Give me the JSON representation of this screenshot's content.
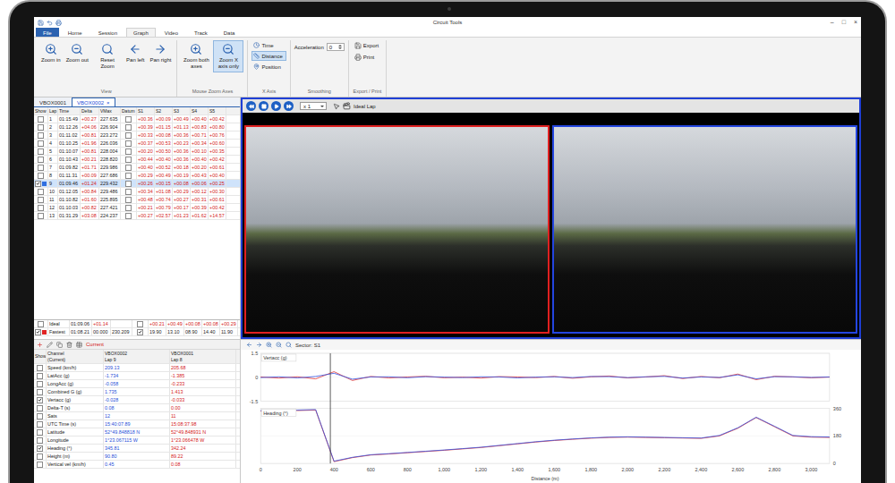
{
  "window": {
    "title": "Circuit Tools",
    "controls": [
      "–",
      "□",
      "×"
    ]
  },
  "ribbon_tabs": [
    {
      "label": "File",
      "kind": "file",
      "selected": false
    },
    {
      "label": "Home",
      "kind": "tab",
      "selected": false
    },
    {
      "label": "Session",
      "kind": "tab",
      "selected": false
    },
    {
      "label": "Graph",
      "kind": "tab",
      "selected": true
    },
    {
      "label": "Video",
      "kind": "tab",
      "selected": false
    },
    {
      "label": "Track",
      "kind": "tab",
      "selected": false
    },
    {
      "label": "Data",
      "kind": "tab",
      "selected": false
    }
  ],
  "ribbon": {
    "view": {
      "label": "View",
      "buttons": [
        {
          "label": "Zoom in"
        },
        {
          "label": "Zoom out"
        },
        {
          "label": "Reset Zoom"
        },
        {
          "label": "Pan left"
        },
        {
          "label": "Pan right"
        }
      ]
    },
    "zoom_axes": {
      "label": "Mouse Zoom Axes",
      "buttons": [
        {
          "label": "Zoom both axes",
          "selected": false
        },
        {
          "label": "Zoom X axis only",
          "selected": true
        }
      ]
    },
    "x_axis": {
      "label": "X Axis",
      "options": [
        {
          "label": "Time",
          "selected": false
        },
        {
          "label": "Distance",
          "selected": true
        },
        {
          "label": "Position",
          "selected": false
        }
      ]
    },
    "smoothing": {
      "label": "Smoothing",
      "field": "Acceleration",
      "value": "0"
    },
    "export": {
      "label": "Export / Print",
      "buttons": [
        "Export",
        "Print"
      ]
    }
  },
  "file_tabs": [
    {
      "label": "VBOX0001",
      "selected": false
    },
    {
      "label": "VBOX0002",
      "selected": true,
      "close": "×"
    }
  ],
  "laps": {
    "columns": [
      "Show",
      "Lap",
      "Time",
      "Delta",
      "VMax",
      "Datum",
      "S1",
      "S2",
      "S3",
      "S4",
      "S5"
    ],
    "rows": [
      {
        "lap": "1",
        "time": "01:15.49",
        "delta": "+00.27",
        "vmax": "227.635",
        "sectors": [
          "+00.36",
          "+00.09",
          "+00.49",
          "+00.40",
          "+00.42"
        ],
        "show": false,
        "datum": false,
        "selected": false
      },
      {
        "lap": "2",
        "time": "01:12.26",
        "delta": "+04.06",
        "vmax": "226.904",
        "sectors": [
          "+00.39",
          "+01.15",
          "+01.13",
          "+00.83",
          "+00.80"
        ],
        "show": false,
        "datum": false,
        "selected": false
      },
      {
        "lap": "3",
        "time": "01:11.02",
        "delta": "+00.81",
        "vmax": "223.272",
        "sectors": [
          "+00.33",
          "+00.08",
          "+00.36",
          "+00.71",
          "+00.76"
        ],
        "show": false,
        "datum": false,
        "selected": false
      },
      {
        "lap": "4",
        "time": "01:10.25",
        "delta": "+01.96",
        "vmax": "226.036",
        "sectors": [
          "+00.37",
          "+00.53",
          "+00.23",
          "+00.34",
          "+00.60"
        ],
        "show": false,
        "datum": false,
        "selected": false
      },
      {
        "lap": "5",
        "time": "01:10.07",
        "delta": "+00.81",
        "vmax": "228.004",
        "sectors": [
          "+00.20",
          "+00.50",
          "+00.36",
          "+00.10",
          "+00.35"
        ],
        "show": false,
        "datum": false,
        "selected": false
      },
      {
        "lap": "6",
        "time": "01:10.43",
        "delta": "+00.21",
        "vmax": "228.820",
        "sectors": [
          "+00.44",
          "+00.40",
          "+00.36",
          "+00.40",
          "+00.42"
        ],
        "show": false,
        "datum": false,
        "selected": false
      },
      {
        "lap": "7",
        "time": "01:09.82",
        "delta": "+01.71",
        "vmax": "229.986",
        "sectors": [
          "+00.40",
          "+00.52",
          "+00.18",
          "+00.20",
          "+00.61"
        ],
        "show": false,
        "datum": false,
        "selected": false
      },
      {
        "lap": "8",
        "time": "01:11.31",
        "delta": "+00.09",
        "vmax": "227.686",
        "sectors": [
          "+00.29",
          "+00.49",
          "+00.19",
          "+00.43",
          "+00.40"
        ],
        "show": false,
        "datum": false,
        "selected": false
      },
      {
        "lap": "9",
        "time": "01:09.46",
        "delta": "+01.24",
        "vmax": "229.432",
        "sectors": [
          "+00.26",
          "+00.15",
          "+00.08",
          "+00.06",
          "+00.25"
        ],
        "show": true,
        "datum": false,
        "selected": true,
        "color": "#2f6fe0"
      },
      {
        "lap": "10",
        "time": "01:12.05",
        "delta": "+00.84",
        "vmax": "229.486",
        "sectors": [
          "+00.34",
          "+01.08",
          "+00.29",
          "+00.12",
          "+00.30"
        ],
        "show": false,
        "datum": false,
        "selected": false
      },
      {
        "lap": "11",
        "time": "01:10.82",
        "delta": "+01.60",
        "vmax": "225.895",
        "sectors": [
          "+00.48",
          "+00.74",
          "+00.27",
          "+00.31",
          "+00.61"
        ],
        "show": false,
        "datum": false,
        "selected": false
      },
      {
        "lap": "12",
        "time": "01:10.03",
        "delta": "+00.82",
        "vmax": "227.421",
        "sectors": [
          "+00.21",
          "+00.79",
          "+00.17",
          "+00.39",
          "+00.42"
        ],
        "show": false,
        "datum": false,
        "selected": false
      },
      {
        "lap": "13",
        "time": "01:31.29",
        "delta": "+03.08",
        "vmax": "224.237",
        "sectors": [
          "+00.27",
          "+02.57",
          "+01.23",
          "+01.62",
          "+14.57"
        ],
        "show": false,
        "datum": false,
        "selected": false
      }
    ],
    "summary": [
      {
        "label": "Ideal",
        "kind": "ideal",
        "time": "01:09.06",
        "delta": "+01.14",
        "sectors": [
          "+00.21",
          "+00.49",
          "+00.08",
          "+00.08",
          "+00.29"
        ],
        "show": false,
        "datum": false
      },
      {
        "label": "Fastest",
        "kind": "fastest",
        "time": "01:08.21",
        "delta": "00.000",
        "vmax": "230.209",
        "sectors": [
          "19.90",
          "13.10",
          "08.90",
          "14.40",
          "11.90"
        ],
        "show": true,
        "datum": true,
        "color": "#e02424"
      }
    ]
  },
  "channels": {
    "toolbar_label": "Current",
    "columns": [
      {
        "title": "Show"
      },
      {
        "title": "Channel",
        "sub": "(Current)"
      },
      {
        "title": "VBOX0002",
        "sub": "Lap 9"
      },
      {
        "title": "VBOX0001",
        "sub": "Lap 8"
      }
    ],
    "rows": [
      {
        "name": "Speed (km/h)",
        "a": "209.13",
        "b": "205.68",
        "checked": false
      },
      {
        "name": "LatAcc (g)",
        "a": "-1.734",
        "b": "-1.385",
        "checked": false
      },
      {
        "name": "LongAcc (g)",
        "a": "-0.058",
        "b": "-0.233",
        "checked": false
      },
      {
        "name": "Combined G (g)",
        "a": "1.735",
        "b": "1.413",
        "checked": false
      },
      {
        "name": "Vertacc (g)",
        "a": "-0.028",
        "b": "-0.033",
        "checked": true
      },
      {
        "name": "Delta-T (s)",
        "a": "0.08",
        "b": "0.00",
        "checked": false
      },
      {
        "name": "Sats",
        "a": "12",
        "b": "11",
        "checked": false
      },
      {
        "name": "UTC Time (s)",
        "a": "15:40:07.89",
        "b": "15:08:37.98",
        "checked": false
      },
      {
        "name": "Latitude",
        "a": "52°49.848818 N",
        "b": "52°49.848931 N",
        "checked": false
      },
      {
        "name": "Longitude",
        "a": "1°23.067115 W",
        "b": "1°23.066478 W",
        "checked": false
      },
      {
        "name": "Heading (°)",
        "a": "345.81",
        "b": "342.24",
        "checked": true
      },
      {
        "name": "Height (m)",
        "a": "90.80",
        "b": "89.22",
        "checked": false
      },
      {
        "name": "Vertical vel (km/h)",
        "a": "0.45",
        "b": "0.08",
        "checked": false
      }
    ]
  },
  "video": {
    "speed": "x 1",
    "mode": "Ideal Lap",
    "frames": [
      {
        "color": "#e02020"
      },
      {
        "color": "#2345e0"
      }
    ]
  },
  "graph": {
    "sector": "Sector: S1",
    "x_label": "Distance (m)",
    "x_ticks": [
      "0",
      "200",
      "400",
      "600",
      "800",
      "1,000",
      "1,200",
      "1,400",
      "1,600",
      "1,800",
      "2,000",
      "2,200",
      "2,400",
      "2,600",
      "2,800",
      "3,000"
    ],
    "x": [
      0,
      100,
      200,
      300,
      400,
      500,
      600,
      700,
      800,
      900,
      1000,
      1100,
      1200,
      1300,
      1400,
      1500,
      1600,
      1700,
      1800,
      1900,
      2000,
      2100,
      2200,
      2300,
      2400,
      2500,
      2600,
      2700,
      2800,
      2900,
      3000,
      3100
    ],
    "cursor": 380,
    "panes": [
      {
        "title": "Vertacc (g)",
        "ticks": [
          "1.5",
          "0",
          "-1.5"
        ],
        "series": [
          {
            "color": "#e03030",
            "values": [
              0.02,
              -0.05,
              0.03,
              -0.1,
              0.35,
              -0.2,
              0.05,
              -0.04,
              0.02,
              0.06,
              -0.03,
              0.01,
              -0.05,
              0.04,
              0.02,
              -0.02,
              0.05,
              -0.06,
              0.03,
              0.08,
              -0.04,
              0.02,
              0.1,
              -0.08,
              0.05,
              -0.03,
              0.2,
              -0.15,
              0.06,
              0.02,
              -0.03,
              0.01
            ]
          },
          {
            "color": "#3050e0",
            "values": [
              -0.02,
              0.03,
              -0.04,
              0.05,
              0.25,
              -0.12,
              0.02,
              0.03,
              -0.03,
              0.04,
              0.01,
              -0.02,
              0.03,
              0.02,
              -0.04,
              0.01,
              0.03,
              -0.02,
              0.05,
              0.04,
              -0.02,
              0.03,
              0.06,
              -0.05,
              0.02,
              -0.01,
              0.15,
              -0.1,
              0.04,
              0.03,
              -0.01,
              0.02
            ]
          }
        ]
      },
      {
        "title": "Heading (°)",
        "ticks": [
          "360",
          "180",
          "0"
        ],
        "series": [
          {
            "color": "#e03030",
            "values": [
              342,
              344,
              346,
              349,
              12,
              38,
              55,
              62,
              70,
              78,
              86,
              95,
              104,
              116,
              128,
              140,
              150,
              158,
              165,
              170,
              172,
              170,
              168,
              166,
              164,
              180,
              230,
              300,
              240,
              180,
              172,
              170
            ]
          },
          {
            "color": "#3050e0",
            "values": [
              345,
              347,
              349,
              352,
              15,
              40,
              57,
              64,
              72,
              80,
              88,
              97,
              106,
              118,
              130,
              142,
              152,
              160,
              167,
              172,
              174,
              172,
              170,
              168,
              166,
              183,
              233,
              302,
              243,
              183,
              175,
              173
            ]
          }
        ]
      }
    ]
  }
}
